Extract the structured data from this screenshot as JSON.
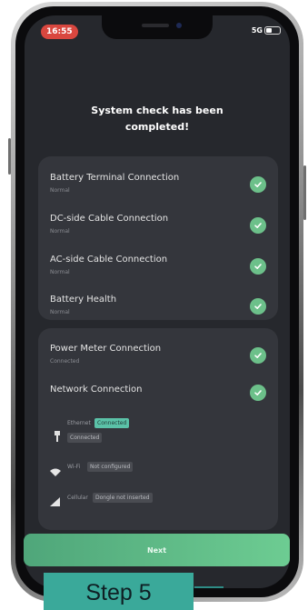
{
  "status_bar": {
    "time": "16:55",
    "network": "5G",
    "battery_level": 0.4
  },
  "headline": {
    "line1": "System check has been",
    "line2": "completed!"
  },
  "checks_primary": [
    {
      "label": "Battery Terminal Connection",
      "status": "Normal"
    },
    {
      "label": "DC-side Cable Connection",
      "status": "Normal"
    },
    {
      "label": "AC-side Cable Connection",
      "status": "Normal"
    },
    {
      "label": "Battery Health",
      "status": "Normal"
    }
  ],
  "checks_secondary": {
    "power_meter": {
      "label": "Power Meter Connection",
      "status": "Connected"
    },
    "network": {
      "label": "Network Connection"
    },
    "ethernet": {
      "label": "Ethernet",
      "value": "Connected",
      "secondary": "Connected"
    },
    "wifi": {
      "label": "Wi-Fi",
      "value": "Not configured"
    },
    "cellular": {
      "label": "Cellular",
      "value": "Dongle not inserted"
    }
  },
  "next_button": {
    "label": "Next"
  },
  "caption": {
    "text": "Step 5"
  },
  "colors": {
    "screen_bg": "#26282d",
    "card_bg": "#34363c",
    "accent_green": "#6cc08a",
    "caption_bg": "#3aa99a"
  },
  "icons": {
    "check": "check-circle-icon",
    "ethernet": "ethernet-icon",
    "wifi": "wifi-icon",
    "cellular": "cellular-signal-icon"
  }
}
